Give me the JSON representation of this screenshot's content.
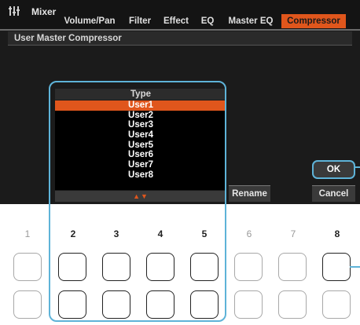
{
  "header": {
    "title": "Mixer",
    "tabs": [
      "Volume/Pan",
      "Filter",
      "Effect",
      "EQ",
      "Master EQ",
      "Compressor"
    ],
    "active_tab": "Compressor"
  },
  "panel": {
    "title": "User Master Compressor"
  },
  "type_list": {
    "header": "Type",
    "items": [
      "User1",
      "User2",
      "User3",
      "User4",
      "User5",
      "User6",
      "User7",
      "User8"
    ],
    "selected": "User1",
    "scroll_indicator": "▲▼"
  },
  "buttons": {
    "rename": "Rename",
    "ok": "OK",
    "cancel": "Cancel"
  },
  "panel_buttons": {
    "numbers": [
      "1",
      "2",
      "3",
      "4",
      "5",
      "6",
      "7",
      "8"
    ]
  },
  "colors": {
    "accent": "#e0561c",
    "callout": "#5eb3d8"
  }
}
